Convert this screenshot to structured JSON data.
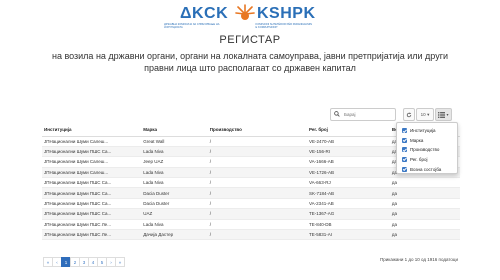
{
  "logo": {
    "left_word": "ΔKCK",
    "left_sub": "ДРЖАВНА КОМИСИЈА ЗА СПРЕЧУВАЊЕ НА КОРУПЦИЈАТА",
    "right_word": "KSHPK",
    "right_sub": "KOMISIONI SHTETËROR PËR PARANDALIMIN E KORRUPSIONIT"
  },
  "title": {
    "main": "РЕГИСТАР",
    "sub": "на возила на државни органи, органи на локалната самоуправа, јавни претпријатија или други правни лица што располагаат со државен капитал"
  },
  "toolbar": {
    "search_placeholder": "Барај",
    "page_size": "10"
  },
  "table": {
    "columns": [
      "Институција",
      "Марка",
      "Производство",
      "Рег. број",
      "Возна"
    ],
    "rows": [
      [
        "ЈПНационални Шуми Салеш...",
        "Great Wall",
        "/",
        "VE-2470-AB",
        "да"
      ],
      [
        "ЈПНационални Шуми ПШС Са...",
        "Lada Niva",
        "/",
        "VE-156-RI",
        "да"
      ],
      [
        "ЈПНационални Шуми Салеш...",
        "Jeep UAZ",
        "/",
        "VA-1666-AB",
        "да"
      ],
      [
        "ЈПНационални Шуми Салеш...",
        "Lada Niva",
        "/",
        "VE-1726-AB",
        "да"
      ],
      [
        "ЈПНационални Шуми ПШС Са...",
        "Lada Niva",
        "/",
        "VA-663-RJ",
        "да"
      ],
      [
        "ЈПНационални Шуми ПШС Са...",
        "Dacia Duster",
        "/",
        "SK-7184-AB",
        "да"
      ],
      [
        "ЈПНационални Шуми ПШС Са...",
        "Dacia Duster",
        "/",
        "VA-2341-AB",
        "да"
      ],
      [
        "ЈПНационални Шуми ПШС Са...",
        "UAZ",
        "/",
        "TE-1367-AG",
        "да"
      ],
      [
        "ЈПНационални Шуми ПШС Ле...",
        "Lada Niva",
        "/",
        "TE-840-DB",
        "да"
      ],
      [
        "ЈПНационални Шуми ПШС Ле...",
        "Дачија Дастер",
        "/",
        "TE-5831-AI",
        "да"
      ]
    ]
  },
  "column_menu": {
    "items": [
      "Институција",
      "Марка",
      "Производство",
      "Рег. број",
      "Возна состојба"
    ]
  },
  "pagination": {
    "first": "«",
    "prev": "‹",
    "pages": [
      "1",
      "2",
      "3",
      "4",
      "5"
    ],
    "next": "›",
    "last": "»",
    "active_page": "1"
  },
  "footer": {
    "info": "Прикажани 1 до 10 од 1916 податоци"
  },
  "colors": {
    "brand": "#2a6fb7",
    "accent": "#2f6dbb"
  },
  "icons": {
    "search": "search-icon",
    "refresh": "refresh-icon",
    "columns": "list-icon"
  }
}
